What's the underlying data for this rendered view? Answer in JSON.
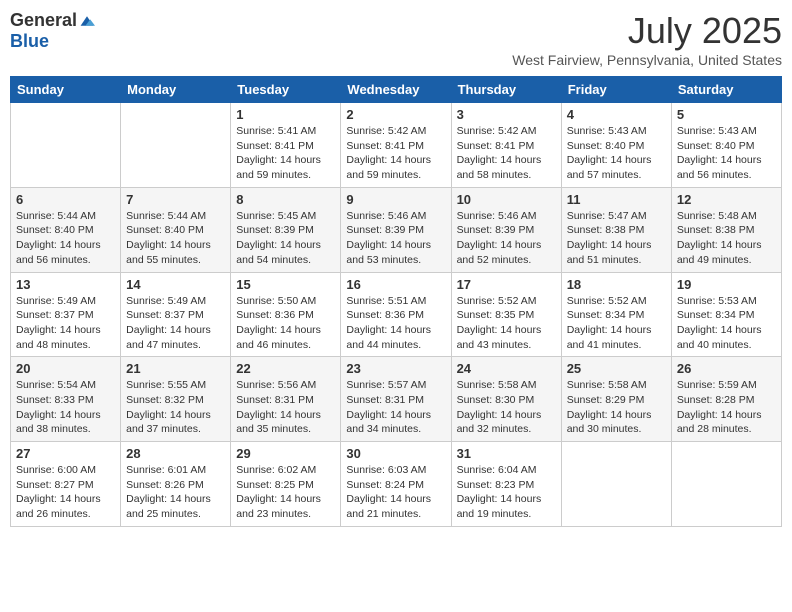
{
  "logo": {
    "general": "General",
    "blue": "Blue"
  },
  "title": "July 2025",
  "location": "West Fairview, Pennsylvania, United States",
  "weekdays": [
    "Sunday",
    "Monday",
    "Tuesday",
    "Wednesday",
    "Thursday",
    "Friday",
    "Saturday"
  ],
  "weeks": [
    [
      {
        "day": "",
        "info": ""
      },
      {
        "day": "",
        "info": ""
      },
      {
        "day": "1",
        "info": "Sunrise: 5:41 AM\nSunset: 8:41 PM\nDaylight: 14 hours and 59 minutes."
      },
      {
        "day": "2",
        "info": "Sunrise: 5:42 AM\nSunset: 8:41 PM\nDaylight: 14 hours and 59 minutes."
      },
      {
        "day": "3",
        "info": "Sunrise: 5:42 AM\nSunset: 8:41 PM\nDaylight: 14 hours and 58 minutes."
      },
      {
        "day": "4",
        "info": "Sunrise: 5:43 AM\nSunset: 8:40 PM\nDaylight: 14 hours and 57 minutes."
      },
      {
        "day": "5",
        "info": "Sunrise: 5:43 AM\nSunset: 8:40 PM\nDaylight: 14 hours and 56 minutes."
      }
    ],
    [
      {
        "day": "6",
        "info": "Sunrise: 5:44 AM\nSunset: 8:40 PM\nDaylight: 14 hours and 56 minutes."
      },
      {
        "day": "7",
        "info": "Sunrise: 5:44 AM\nSunset: 8:40 PM\nDaylight: 14 hours and 55 minutes."
      },
      {
        "day": "8",
        "info": "Sunrise: 5:45 AM\nSunset: 8:39 PM\nDaylight: 14 hours and 54 minutes."
      },
      {
        "day": "9",
        "info": "Sunrise: 5:46 AM\nSunset: 8:39 PM\nDaylight: 14 hours and 53 minutes."
      },
      {
        "day": "10",
        "info": "Sunrise: 5:46 AM\nSunset: 8:39 PM\nDaylight: 14 hours and 52 minutes."
      },
      {
        "day": "11",
        "info": "Sunrise: 5:47 AM\nSunset: 8:38 PM\nDaylight: 14 hours and 51 minutes."
      },
      {
        "day": "12",
        "info": "Sunrise: 5:48 AM\nSunset: 8:38 PM\nDaylight: 14 hours and 49 minutes."
      }
    ],
    [
      {
        "day": "13",
        "info": "Sunrise: 5:49 AM\nSunset: 8:37 PM\nDaylight: 14 hours and 48 minutes."
      },
      {
        "day": "14",
        "info": "Sunrise: 5:49 AM\nSunset: 8:37 PM\nDaylight: 14 hours and 47 minutes."
      },
      {
        "day": "15",
        "info": "Sunrise: 5:50 AM\nSunset: 8:36 PM\nDaylight: 14 hours and 46 minutes."
      },
      {
        "day": "16",
        "info": "Sunrise: 5:51 AM\nSunset: 8:36 PM\nDaylight: 14 hours and 44 minutes."
      },
      {
        "day": "17",
        "info": "Sunrise: 5:52 AM\nSunset: 8:35 PM\nDaylight: 14 hours and 43 minutes."
      },
      {
        "day": "18",
        "info": "Sunrise: 5:52 AM\nSunset: 8:34 PM\nDaylight: 14 hours and 41 minutes."
      },
      {
        "day": "19",
        "info": "Sunrise: 5:53 AM\nSunset: 8:34 PM\nDaylight: 14 hours and 40 minutes."
      }
    ],
    [
      {
        "day": "20",
        "info": "Sunrise: 5:54 AM\nSunset: 8:33 PM\nDaylight: 14 hours and 38 minutes."
      },
      {
        "day": "21",
        "info": "Sunrise: 5:55 AM\nSunset: 8:32 PM\nDaylight: 14 hours and 37 minutes."
      },
      {
        "day": "22",
        "info": "Sunrise: 5:56 AM\nSunset: 8:31 PM\nDaylight: 14 hours and 35 minutes."
      },
      {
        "day": "23",
        "info": "Sunrise: 5:57 AM\nSunset: 8:31 PM\nDaylight: 14 hours and 34 minutes."
      },
      {
        "day": "24",
        "info": "Sunrise: 5:58 AM\nSunset: 8:30 PM\nDaylight: 14 hours and 32 minutes."
      },
      {
        "day": "25",
        "info": "Sunrise: 5:58 AM\nSunset: 8:29 PM\nDaylight: 14 hours and 30 minutes."
      },
      {
        "day": "26",
        "info": "Sunrise: 5:59 AM\nSunset: 8:28 PM\nDaylight: 14 hours and 28 minutes."
      }
    ],
    [
      {
        "day": "27",
        "info": "Sunrise: 6:00 AM\nSunset: 8:27 PM\nDaylight: 14 hours and 26 minutes."
      },
      {
        "day": "28",
        "info": "Sunrise: 6:01 AM\nSunset: 8:26 PM\nDaylight: 14 hours and 25 minutes."
      },
      {
        "day": "29",
        "info": "Sunrise: 6:02 AM\nSunset: 8:25 PM\nDaylight: 14 hours and 23 minutes."
      },
      {
        "day": "30",
        "info": "Sunrise: 6:03 AM\nSunset: 8:24 PM\nDaylight: 14 hours and 21 minutes."
      },
      {
        "day": "31",
        "info": "Sunrise: 6:04 AM\nSunset: 8:23 PM\nDaylight: 14 hours and 19 minutes."
      },
      {
        "day": "",
        "info": ""
      },
      {
        "day": "",
        "info": ""
      }
    ]
  ]
}
